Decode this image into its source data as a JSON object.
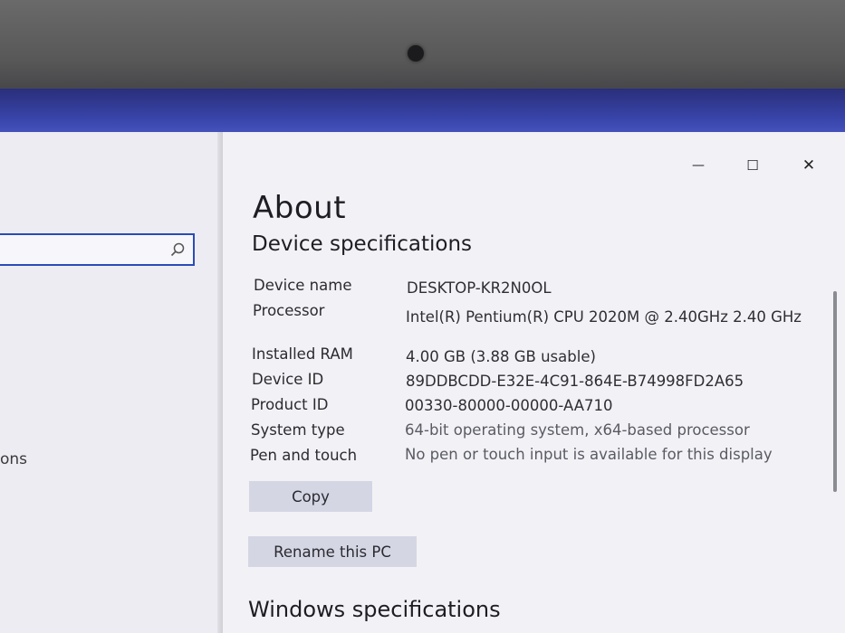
{
  "left_pane": {
    "search_placeholder": "",
    "partial_item": "ons"
  },
  "window": {
    "minimize": "—",
    "maximize": "☐",
    "close": "✕"
  },
  "page": {
    "title": "About",
    "section_device": "Device specifications",
    "section_windows": "Windows specifications"
  },
  "specs": [
    {
      "label": "Device name",
      "value": "DESKTOP-KR2N0OL"
    },
    {
      "label": "Processor",
      "value": "Intel(R) Pentium(R) CPU 2020M @ 2.40GHz   2.40 GHz"
    },
    {
      "label": "Installed RAM",
      "value": "4.00 GB (3.88 GB usable)"
    },
    {
      "label": "Device ID",
      "value": "89DDBCDD-E32E-4C91-864E-B74998FD2A65"
    },
    {
      "label": "Product ID",
      "value": "00330-80000-00000-AA710"
    },
    {
      "label": "System type",
      "value": "64-bit operating system, x64-based processor"
    },
    {
      "label": "Pen and touch",
      "value": "No pen or touch input is available for this display"
    }
  ],
  "buttons": {
    "copy": "Copy",
    "rename": "Rename this PC"
  },
  "icons": {
    "search": "search-icon",
    "minimize": "minimize-icon",
    "maximize": "maximize-icon",
    "close": "close-icon"
  }
}
